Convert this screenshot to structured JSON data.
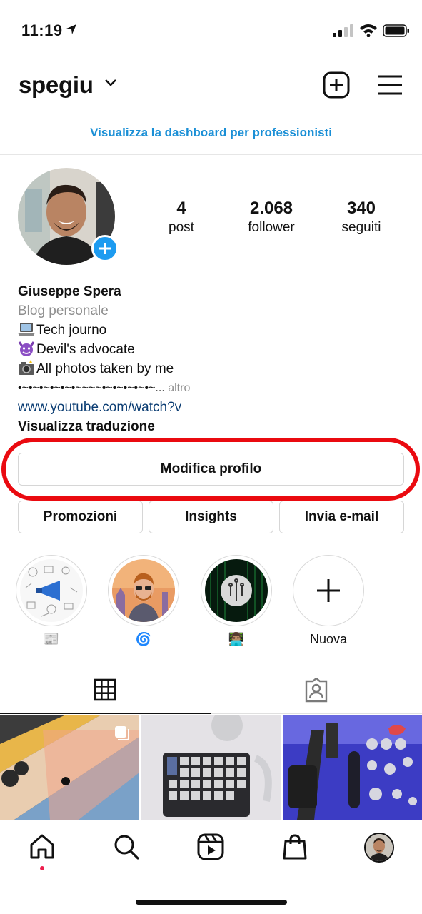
{
  "status_bar": {
    "time": "11:19"
  },
  "header": {
    "username": "spegiu"
  },
  "dashboard_link": "Visualizza la dashboard per professionisti",
  "stats": [
    {
      "value": "4",
      "label": "post"
    },
    {
      "value": "2.068",
      "label": "follower"
    },
    {
      "value": "340",
      "label": "seguiti"
    }
  ],
  "bio": {
    "name": "Giuseppe Spera",
    "category": "Blog personale",
    "lines": [
      "Tech journo",
      "Devil's advocate",
      "All photos taken by me"
    ],
    "line_icons": [
      "laptop-emoji",
      "devil-emoji",
      "camera-flash-emoji"
    ],
    "divider": "•~•~•~•~•~•~~~~•~•~•~•~•~...",
    "more": "altro",
    "link": "www.youtube.com/watch?v",
    "translate": "Visualizza traduzione"
  },
  "buttons": {
    "edit_profile": "Modifica profilo",
    "promotions": "Promozioni",
    "insights": "Insights",
    "email": "Invia e-mail"
  },
  "highlights": [
    {
      "label": "📰",
      "icon": "newspaper-emoji"
    },
    {
      "label": "🌀",
      "icon": "cyclone-emoji"
    },
    {
      "label": "👨🏽‍💻",
      "icon": "technologist-emoji"
    },
    {
      "label": "Nuova",
      "icon": "plus-icon"
    }
  ],
  "colors": {
    "accent_link": "#1a8fd6",
    "highlight_ring_annotation": "#ea0a10",
    "add_badge": "#1d9bf0",
    "notification_dot": "#ed1e4d"
  }
}
